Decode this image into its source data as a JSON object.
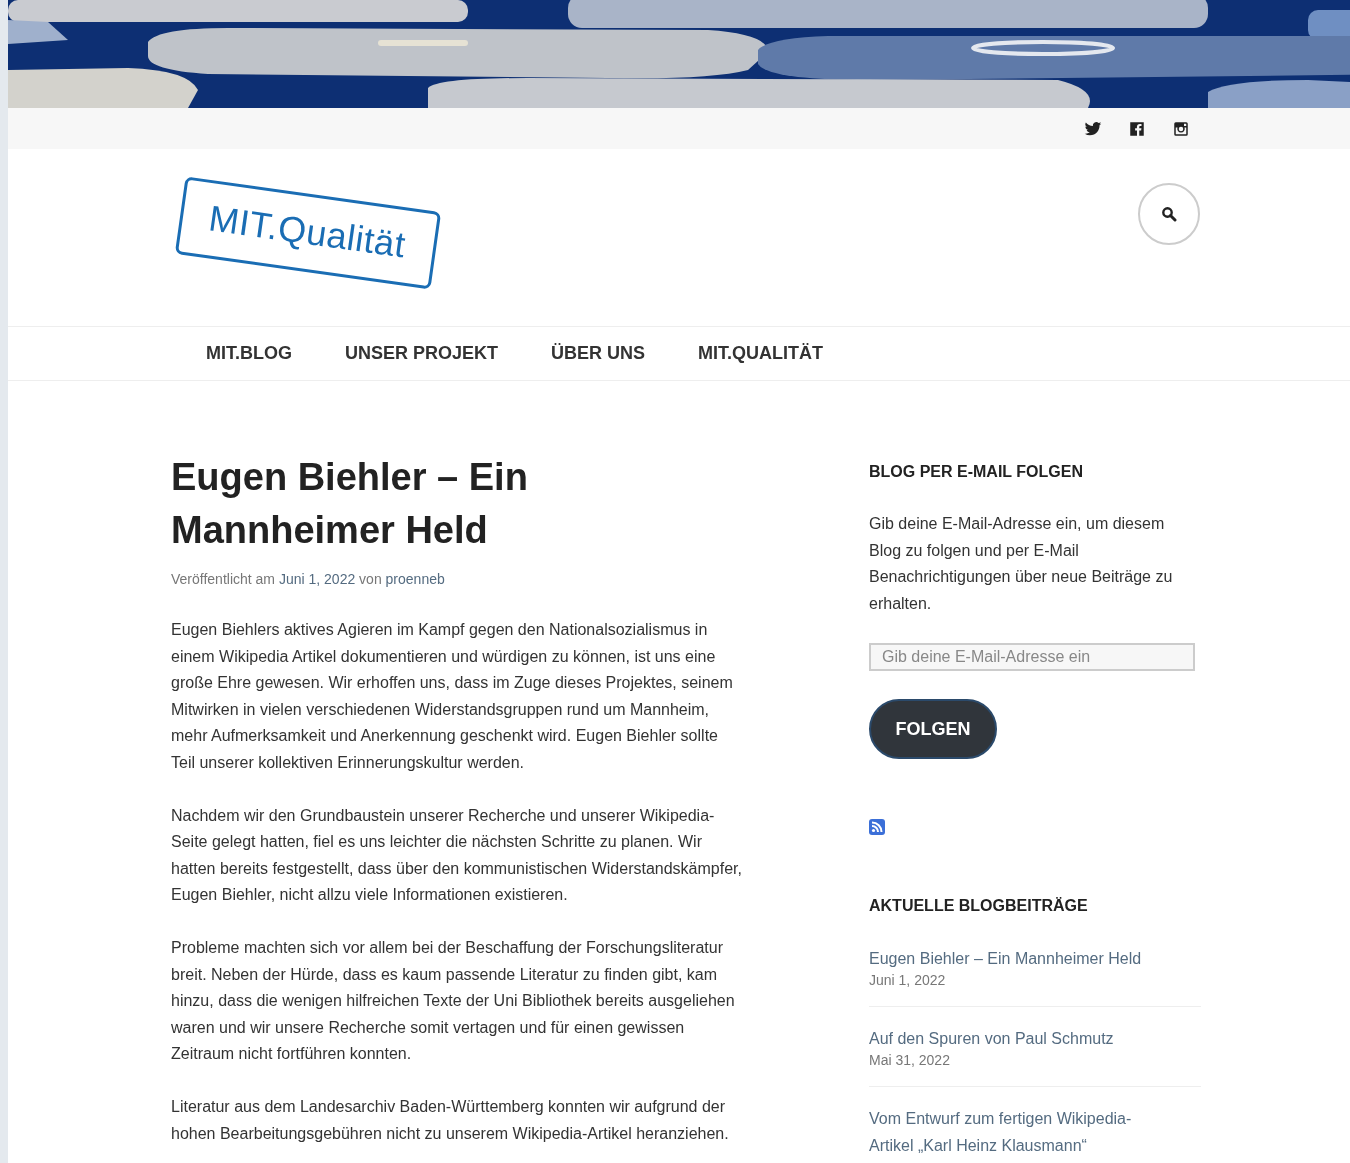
{
  "social_links": [
    {
      "kind": "twitter"
    },
    {
      "kind": "facebook"
    },
    {
      "kind": "instagram"
    }
  ],
  "logo": {
    "text": "MIT.Qualität"
  },
  "navigation": [
    {
      "label": "MIT.BLOG"
    },
    {
      "label": "UNSER PROJEKT"
    },
    {
      "label": "ÜBER UNS"
    },
    {
      "label": "MIT.QUALITÄT"
    }
  ],
  "post": {
    "title": "Eugen Biehler – Ein Mannheimer Held",
    "meta": {
      "published_label": "Veröffentlicht am",
      "date": "Juni 1, 2022",
      "by_label": "von",
      "author": "proenneb"
    },
    "paragraphs": [
      "Eugen Biehlers aktives Agieren im Kampf gegen den Nationalsozialismus in einem Wikipedia Artikel dokumentieren und würdigen zu können, ist uns eine große Ehre gewesen. Wir erhoffen uns, dass im Zuge dieses Projektes, seinem Mitwirken in vielen verschiedenen Widerstandsgruppen rund um Mannheim, mehr Aufmerksamkeit und Anerkennung geschenkt wird. Eugen Biehler sollte Teil unserer kollektiven Erinnerungskultur werden.",
      "Nachdem wir den Grundbaustein unserer Recherche und unserer Wikipedia-Seite gelegt hatten, fiel es uns leichter die nächsten Schritte zu planen. Wir hatten bereits festgestellt, dass über den kommunistischen Widerstandskämpfer, Eugen Biehler, nicht allzu viele Informationen existieren.",
      "Probleme machten sich vor allem bei der Beschaffung der Forschungsliteratur breit. Neben der Hürde, dass es kaum passende Literatur zu finden gibt, kam hinzu, dass die wenigen hilfreichen Texte der Uni Bibliothek bereits ausgeliehen waren und wir unsere Recherche somit vertagen und für einen gewissen Zeitraum nicht fortführen konnten.",
      "Literatur aus dem Landesarchiv Baden-Württemberg konnten wir aufgrund der hohen Bearbeitungsgebühren nicht zu unserem Wikipedia-Artikel heranziehen."
    ]
  },
  "sidebar": {
    "follow_widget": {
      "heading": "BLOG PER E-MAIL FOLGEN",
      "description": "Gib deine E-Mail-Adresse ein, um diesem Blog zu folgen und per E-Mail Benachrichtigungen über neue Beiträge zu erhalten.",
      "email_field": {
        "placeholder": "Gib deine E-Mail-Adresse ein"
      },
      "button": "FOLGEN"
    },
    "recent_posts": {
      "heading": "AKTUELLE BLOGBEITRÄGE",
      "items": [
        {
          "title": "Eugen Biehler – Ein Mannheimer Held",
          "date": "Juni 1, 2022"
        },
        {
          "title": "Auf den Spuren von Paul Schmutz",
          "date": "Mai 31, 2022"
        },
        {
          "title": "Vom Entwurf zum fertigen Wikipedia-Artikel „Karl Heinz Klausmann“"
        }
      ]
    }
  }
}
